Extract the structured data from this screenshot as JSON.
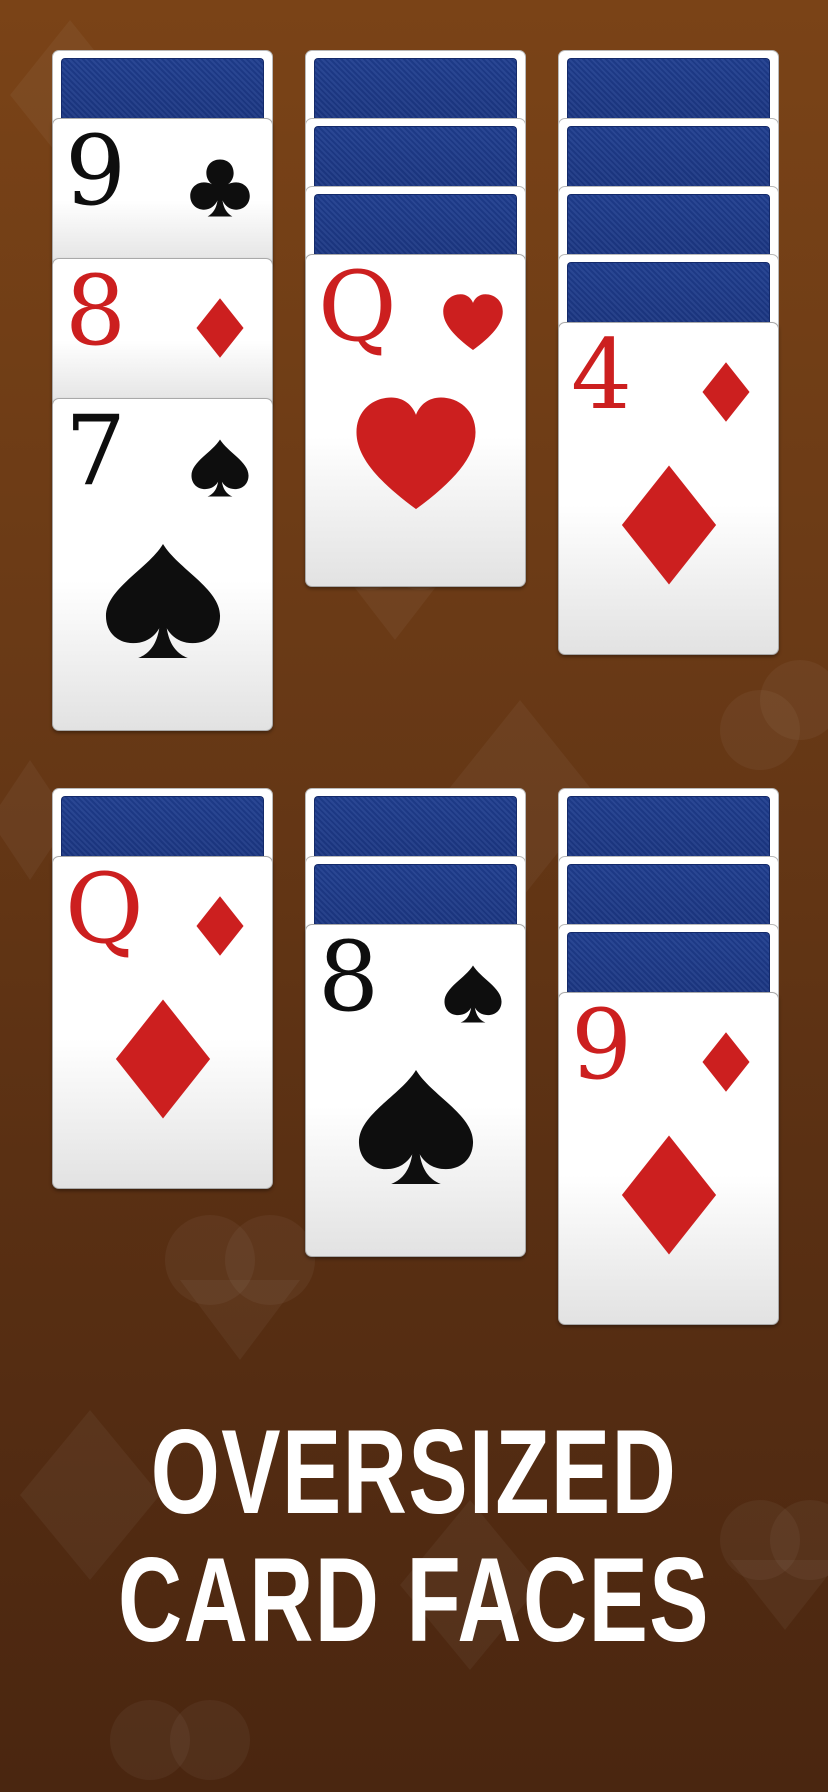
{
  "colors": {
    "background": "#6a3a16",
    "card_back": "#1f3d8e",
    "red_suit": "#cc1f1f",
    "black_suit": "#0e0e0e",
    "headline": "#ffffff"
  },
  "piles": [
    {
      "hidden_count": 1,
      "faces": [
        {
          "rank": "9",
          "suit": "clubs",
          "color": "black",
          "full": false
        },
        {
          "rank": "8",
          "suit": "diamonds",
          "color": "red",
          "full": false
        },
        {
          "rank": "7",
          "suit": "spades",
          "color": "black",
          "full": true
        }
      ]
    },
    {
      "hidden_count": 3,
      "faces": [
        {
          "rank": "Q",
          "suit": "hearts",
          "color": "red",
          "full": true
        }
      ]
    },
    {
      "hidden_count": 4,
      "faces": [
        {
          "rank": "4",
          "suit": "diamonds",
          "color": "red",
          "full": true
        }
      ]
    },
    {
      "hidden_count": 1,
      "faces": [
        {
          "rank": "Q",
          "suit": "diamonds",
          "color": "red",
          "full": true
        }
      ]
    },
    {
      "hidden_count": 2,
      "faces": [
        {
          "rank": "8",
          "suit": "spades",
          "color": "black",
          "full": true
        }
      ]
    },
    {
      "hidden_count": 3,
      "faces": [
        {
          "rank": "9",
          "suit": "diamonds",
          "color": "red",
          "full": true
        }
      ]
    }
  ],
  "headline": {
    "line1": "OVERSIZED",
    "line2": "CARD FACES"
  }
}
